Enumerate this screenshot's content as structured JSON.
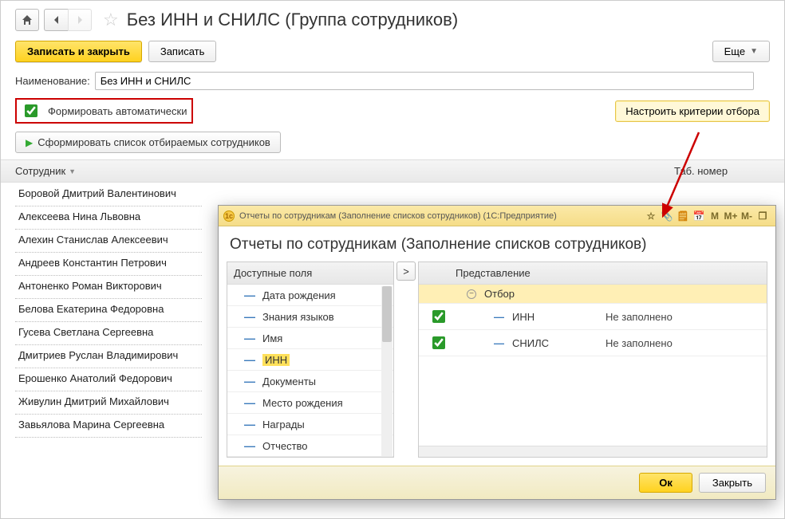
{
  "toolbar": {
    "title": "Без ИНН и СНИЛС (Группа сотрудников)",
    "save_close_label": "Записать и закрыть",
    "save_label": "Записать",
    "more_label": "Еще"
  },
  "form": {
    "name_label": "Наименование:",
    "name_value": "Без ИНН и СНИЛС",
    "auto_label": "Формировать автоматически",
    "configure_criteria_label": "Настроить критерии отбора",
    "generate_list_label": "Сформировать список отбираемых сотрудников"
  },
  "table": {
    "col_employee": "Сотрудник",
    "col_tab_number": "Таб. номер",
    "rows": [
      "Боровой Дмитрий Валентинович",
      "Алексеева Нина Львовна",
      "Алехин Станислав Алексеевич",
      "Андреев Константин Петрович",
      "Антоненко Роман Викторович",
      "Белова Екатерина Федоровна",
      "Гусева Светлана Сергеевна",
      "Дмитриев Руслан Владимирович",
      "Ерошенко Анатолий Федорович",
      "Живулин Дмитрий Михайлович",
      "Завьялова Марина Сергеевна"
    ]
  },
  "popup": {
    "titlebar": "Отчеты по сотрудникам (Заполнение списков сотрудников)  (1С:Предприятие)",
    "M1": "M",
    "M2": "M+",
    "M3": "M-",
    "heading": "Отчеты по сотрудникам (Заполнение списков сотрудников)",
    "available_header": "Доступные поля",
    "available_fields": [
      "Дата рождения",
      "Знания языков",
      "Имя",
      "ИНН",
      "Документы",
      "Место рождения",
      "Награды",
      "Отчество"
    ],
    "highlighted_index": 3,
    "filter": {
      "col_repr": "Представление",
      "category": "Отбор",
      "rows": [
        {
          "checked": true,
          "field": "ИНН",
          "value": "Не заполнено"
        },
        {
          "checked": true,
          "field": "СНИЛС",
          "value": "Не заполнено"
        }
      ]
    },
    "ok_label": "Ок",
    "close_label": "Закрыть"
  }
}
